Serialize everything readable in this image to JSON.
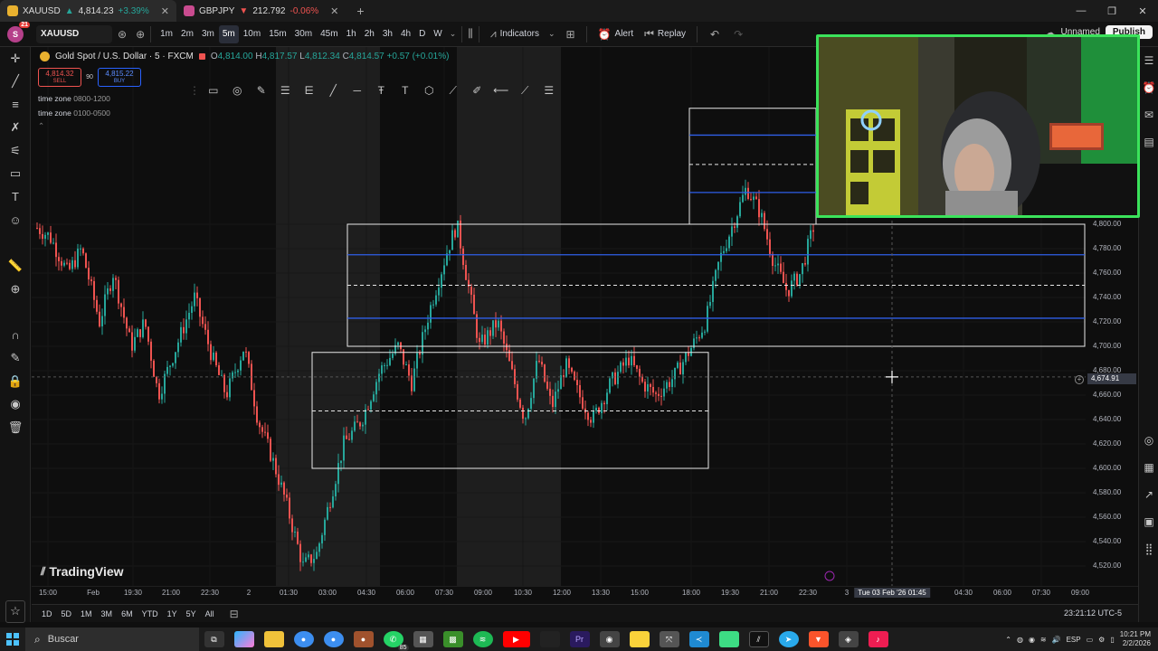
{
  "browser": {
    "tabs": [
      {
        "symbol": "XAUUSD",
        "price": "4,814.23",
        "change": "+3.39%",
        "active": true,
        "color": "#e9b12f"
      },
      {
        "symbol": "GBPJPY",
        "price": "212.792",
        "change": "-0.06%",
        "active": false,
        "color": "#c94b8f"
      }
    ],
    "new_tab": "+",
    "window_controls": [
      "—",
      "❐",
      "✕"
    ]
  },
  "toolbar": {
    "avatar_letter": "S",
    "avatar_badge": "21",
    "symbol": "XAUUSD",
    "timeframes": [
      "1m",
      "2m",
      "3m",
      "5m",
      "10m",
      "15m",
      "30m",
      "45m",
      "1h",
      "2h",
      "3h",
      "4h",
      "D",
      "W"
    ],
    "selected_timeframe": "5m",
    "indicators_label": "Indicators",
    "alert_label": "Alert",
    "replay_label": "Replay",
    "layout_name": "Unnamed",
    "publish_label": "Publish"
  },
  "legend": {
    "title": "Gold Spot / U.S. Dollar · 5 · FXCM",
    "open_label": "O",
    "open": "4,814.00",
    "high_label": "H",
    "high": "4,817.57",
    "low_label": "L",
    "low": "4,812.34",
    "close_label": "C",
    "close": "4,814.57",
    "change": "+0.57 (+0.01%)"
  },
  "trade": {
    "sell_price": "4,814.32",
    "sell_label": "SELL",
    "spread": "90",
    "buy_price": "4,815.22",
    "buy_label": "BUY"
  },
  "indicators": [
    {
      "name": "time zone",
      "value": "0800-1200"
    },
    {
      "name": "time zone",
      "value": "0100-0500"
    }
  ],
  "price_axis": {
    "labels": [
      "4,800.00",
      "4,780.00",
      "4,760.00",
      "4,740.00",
      "4,720.00",
      "4,700.00",
      "4,680.00",
      "4,660.00",
      "4,640.00",
      "4,620.00",
      "4,600.00",
      "4,580.00",
      "4,560.00",
      "4,540.00",
      "4,520.00"
    ],
    "crosshair_price": "4,674.91"
  },
  "time_axis": {
    "labels": [
      "15:00",
      "Feb",
      "19:30",
      "21:00",
      "22:30",
      "2",
      "01:30",
      "03:00",
      "04:30",
      "06:00",
      "07:30",
      "09:00",
      "10:30",
      "12:00",
      "13:30",
      "15:00",
      "18:00",
      "19:30",
      "21:00",
      "22:30",
      "3",
      "01:45",
      "04:30",
      "06:00",
      "07:30",
      "09:00"
    ],
    "crosshair_time": "Tue 03 Feb '26  01:45"
  },
  "branding": "TradingView",
  "range_buttons": [
    "1D",
    "5D",
    "1M",
    "3M",
    "6M",
    "YTD",
    "1Y",
    "5Y",
    "All"
  ],
  "timezone_display": "23:21:12 UTC-5",
  "taskbar": {
    "search_placeholder": "Buscar",
    "whatsapp_badge": "85",
    "language": "ESP",
    "time": "10:21 PM",
    "date": "2/2/2026"
  },
  "chart_data": {
    "type": "candlestick",
    "instrument": "Gold Spot / U.S. Dollar",
    "timeframe": "5",
    "ylim": [
      4510,
      4830
    ],
    "zones": [
      {
        "name": "range-1",
        "top": 4695,
        "bottom": 4600,
        "mid": 4647
      },
      {
        "name": "range-2",
        "top": 4800,
        "bottom": 4700,
        "mid": 4750,
        "upper_line": 4775,
        "lower_line": 4723
      },
      {
        "name": "range-3",
        "top": 4895,
        "bottom": 4800,
        "mid": 4849,
        "upper_line": 4873,
        "lower_line": 4826
      }
    ],
    "price_path": [
      [
        0,
        4800
      ],
      [
        20,
        4790
      ],
      [
        40,
        4760
      ],
      [
        55,
        4780
      ],
      [
        75,
        4720
      ],
      [
        90,
        4760
      ],
      [
        110,
        4700
      ],
      [
        125,
        4720
      ],
      [
        140,
        4660
      ],
      [
        160,
        4700
      ],
      [
        180,
        4740
      ],
      [
        200,
        4690
      ],
      [
        215,
        4660
      ],
      [
        235,
        4700
      ],
      [
        250,
        4640
      ],
      [
        265,
        4610
      ],
      [
        280,
        4575
      ],
      [
        300,
        4520
      ],
      [
        315,
        4530
      ],
      [
        330,
        4575
      ],
      [
        345,
        4620
      ],
      [
        365,
        4640
      ],
      [
        385,
        4680
      ],
      [
        405,
        4700
      ],
      [
        420,
        4670
      ],
      [
        440,
        4730
      ],
      [
        460,
        4780
      ],
      [
        470,
        4800
      ],
      [
        480,
        4760
      ],
      [
        495,
        4700
      ],
      [
        515,
        4720
      ],
      [
        530,
        4680
      ],
      [
        545,
        4640
      ],
      [
        560,
        4690
      ],
      [
        575,
        4650
      ],
      [
        590,
        4685
      ],
      [
        605,
        4660
      ],
      [
        620,
        4640
      ],
      [
        640,
        4670
      ],
      [
        660,
        4690
      ],
      [
        675,
        4670
      ],
      [
        690,
        4660
      ],
      [
        710,
        4675
      ],
      [
        730,
        4700
      ],
      [
        745,
        4720
      ],
      [
        760,
        4770
      ],
      [
        775,
        4800
      ],
      [
        790,
        4830
      ],
      [
        805,
        4810
      ],
      [
        820,
        4770
      ],
      [
        835,
        4745
      ],
      [
        850,
        4760
      ],
      [
        865,
        4800
      ]
    ]
  }
}
